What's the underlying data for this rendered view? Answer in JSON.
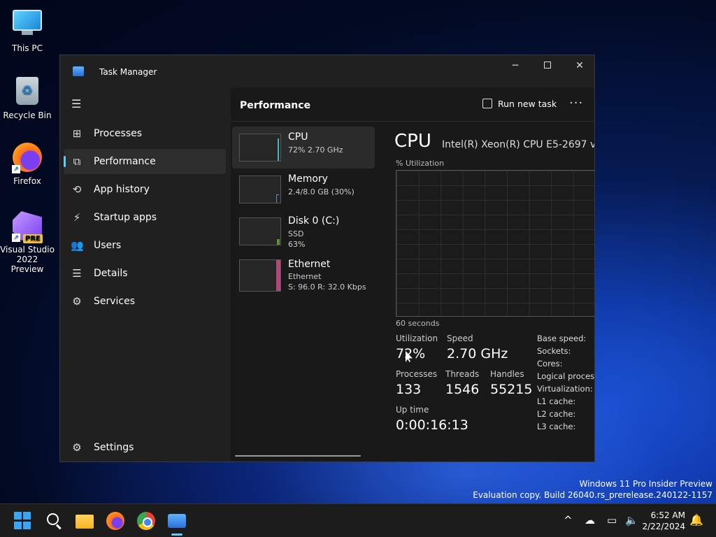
{
  "desktop": {
    "icons": [
      {
        "label": "This PC"
      },
      {
        "label": "Recycle Bin"
      },
      {
        "label": "Firefox"
      },
      {
        "label": "Visual Studio 2022 Preview",
        "badge": "PRE"
      }
    ]
  },
  "window": {
    "title": "Task Manager",
    "controls": {
      "minimize": "─",
      "close": "✕"
    }
  },
  "nav": {
    "menu_icon": "☰",
    "items": [
      {
        "label": "Processes",
        "icon": "⊞"
      },
      {
        "label": "Performance",
        "icon": "⧉",
        "active": true
      },
      {
        "label": "App history",
        "icon": "⟲"
      },
      {
        "label": "Startup apps",
        "icon": "⚡"
      },
      {
        "label": "Users",
        "icon": "👥"
      },
      {
        "label": "Details",
        "icon": "☰"
      },
      {
        "label": "Services",
        "icon": "⚙"
      }
    ],
    "settings": {
      "label": "Settings",
      "icon": "⚙"
    }
  },
  "header": {
    "title": "Performance",
    "run_new_task": "Run new task",
    "more": "···"
  },
  "perf_items": [
    {
      "name": "CPU",
      "sub1": "72%  2.70 GHz",
      "sub2": "",
      "color": "#3fb6c9"
    },
    {
      "name": "Memory",
      "sub1": "2.4/8.0 GB (30%)",
      "sub2": "",
      "color": "#5b8fd8"
    },
    {
      "name": "Disk 0 (C:)",
      "sub1": "SSD",
      "sub2": "63%",
      "color": "#7bbd3a"
    },
    {
      "name": "Ethernet",
      "sub1": "Ethernet",
      "sub2": "S: 96.0  R: 32.0 Kbps",
      "color": "#d04d8a"
    }
  ],
  "cpu_detail": {
    "heading": "CPU",
    "model": "Intel(R) Xeon(R) CPU E5-2697 v",
    "util_label": "% Utilization",
    "time_label": "60 seconds",
    "stats": {
      "utilization_label": "Utilization",
      "utilization_value": "72%",
      "speed_label": "Speed",
      "speed_value": "2.70 GHz",
      "processes_label": "Processes",
      "processes_value": "133",
      "threads_label": "Threads",
      "threads_value": "1546",
      "handles_label": "Handles",
      "handles_value": "55215",
      "uptime_label": "Up time",
      "uptime_value": "0:00:16:13"
    },
    "specs": [
      "Base speed:",
      "Sockets:",
      "Cores:",
      "Logical processo",
      "Virtualization:",
      "L1 cache:",
      "L2 cache:",
      "L3 cache:"
    ]
  },
  "watermark": {
    "line1": "Windows 11 Pro Insider Preview",
    "line2": "Evaluation copy. Build 26040.rs_prerelease.240122-1157"
  },
  "taskbar": {
    "tray_chevron": "^",
    "time": "6:52 AM",
    "date": "2/22/2024",
    "bell": "🔔"
  }
}
